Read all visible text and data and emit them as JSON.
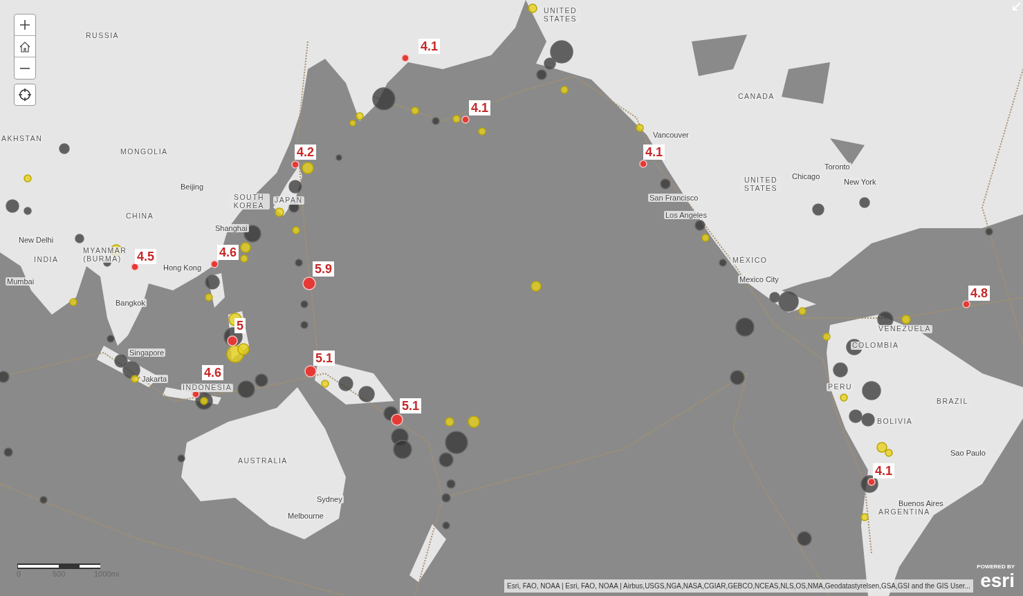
{
  "map_controls": [
    {
      "kind": "zoom_in"
    },
    {
      "kind": "home"
    },
    {
      "kind": "zoom_out"
    },
    {
      "kind": "locate"
    },
    {
      "kind": "expand"
    }
  ],
  "place_labels": [
    {
      "text": "RUSSIA",
      "kind": "country"
    },
    {
      "text": "UNITED STATES",
      "kind": "country"
    },
    {
      "text": "CANADA",
      "kind": "country"
    },
    {
      "text": "AKHSTAN",
      "kind": "country"
    },
    {
      "text": "MONGOLIA",
      "kind": "country"
    },
    {
      "text": "Beijing",
      "kind": "city"
    },
    {
      "text": "SOUTH KOREA",
      "kind": "country"
    },
    {
      "text": "JAPAN",
      "kind": "country"
    },
    {
      "text": "CHINA",
      "kind": "country"
    },
    {
      "text": "Shanghai",
      "kind": "city"
    },
    {
      "text": "New Delhi",
      "kind": "city"
    },
    {
      "text": "INDIA",
      "kind": "country"
    },
    {
      "text": "MYANMAR (BURMA)",
      "kind": "country"
    },
    {
      "text": "Mumbai",
      "kind": "city"
    },
    {
      "text": "Hong Kong",
      "kind": "city"
    },
    {
      "text": "Bangkok",
      "kind": "city"
    },
    {
      "text": "Singapore",
      "kind": "city"
    },
    {
      "text": "Jakarta",
      "kind": "city"
    },
    {
      "text": "INDONESIA",
      "kind": "country"
    },
    {
      "text": "AUSTRALIA",
      "kind": "country"
    },
    {
      "text": "Sydney",
      "kind": "city"
    },
    {
      "text": "Melbourne",
      "kind": "city"
    },
    {
      "text": "Vancouver",
      "kind": "city"
    },
    {
      "text": "Toronto",
      "kind": "city"
    },
    {
      "text": "Chicago",
      "kind": "city"
    },
    {
      "text": "New York",
      "kind": "city"
    },
    {
      "text": "UNITED STATES",
      "kind": "country"
    },
    {
      "text": "San Francisco",
      "kind": "city"
    },
    {
      "text": "Los Angeles",
      "kind": "city"
    },
    {
      "text": "MÉXICO",
      "kind": "country"
    },
    {
      "text": "Mexico City",
      "kind": "city"
    },
    {
      "text": "VENEZUELA",
      "kind": "country"
    },
    {
      "text": "COLOMBIA",
      "kind": "country"
    },
    {
      "text": "PERU",
      "kind": "country"
    },
    {
      "text": "BRAZIL",
      "kind": "country"
    },
    {
      "text": "BOLIVIA",
      "kind": "country"
    },
    {
      "text": "Sao Paulo",
      "kind": "city"
    },
    {
      "text": "Buenos Aires",
      "kind": "city"
    },
    {
      "text": "ARGENTINA",
      "kind": "country"
    }
  ],
  "labeled_earthquakes": [
    {
      "magnitude": "4.1"
    },
    {
      "magnitude": "4.1"
    },
    {
      "magnitude": "4.2"
    },
    {
      "magnitude": "4.1"
    },
    {
      "magnitude": "4.5"
    },
    {
      "magnitude": "4.6"
    },
    {
      "magnitude": "5.9"
    },
    {
      "magnitude": "5"
    },
    {
      "magnitude": "5.1"
    },
    {
      "magnitude": "4.6"
    },
    {
      "magnitude": "5.1"
    },
    {
      "magnitude": "4.8"
    },
    {
      "magnitude": "4.1"
    }
  ],
  "scale_bar": {
    "labels": [
      "0",
      "500",
      "1000mi"
    ]
  },
  "attribution": "Esri, FAO, NOAA | Esri, FAO, NOAA | Airbus,USGS,NGA,NASA,CGIAR,GEBCO,NCEAS,NLS,OS,NMA,Geodatastyrelsen,GSA,GSI and the GIS User...",
  "logo": {
    "caption": "POWERED BY",
    "wordmark": "esri"
  }
}
